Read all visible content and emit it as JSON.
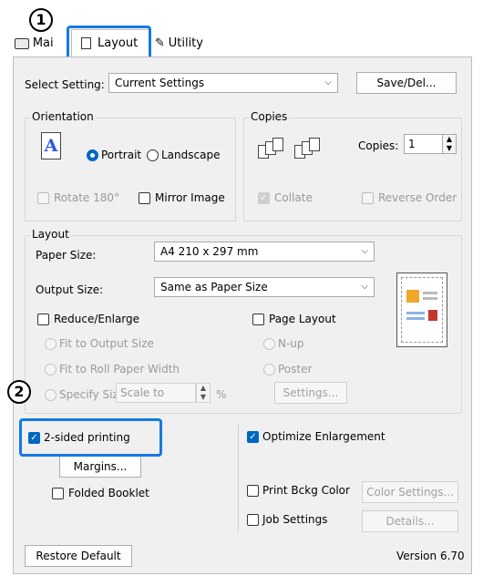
{
  "tabs": [
    {
      "label": "Mai"
    },
    {
      "label": "Layout"
    },
    {
      "label": "Utility"
    }
  ],
  "callouts": {
    "step1": "1",
    "step2": "2"
  },
  "select_setting": {
    "label": "Select Setting:",
    "value": "Current Settings",
    "save_button": "Save/Del..."
  },
  "orientation": {
    "title": "Orientation",
    "portrait": "Portrait",
    "landscape": "Landscape",
    "selected": "Portrait",
    "rotate": "Rotate 180°",
    "mirror": "Mirror Image",
    "preview_glyph": "A"
  },
  "copies": {
    "title": "Copies",
    "label": "Copies:",
    "value": "1",
    "collate": "Collate",
    "reverse": "Reverse Order"
  },
  "layout": {
    "title": "Layout",
    "paper_size_label": "Paper Size:",
    "paper_size_value": "A4 210 x 297 mm",
    "output_size_label": "Output Size:",
    "output_size_value": "Same as Paper Size",
    "reduce_enlarge": "Reduce/Enlarge",
    "fit_output": "Fit to Output Size",
    "fit_roll": "Fit to Roll Paper Width",
    "specify_size": "Specify Size",
    "scale_to": "Scale to",
    "percent": "%",
    "page_layout": "Page Layout",
    "nup": "N-up",
    "poster": "Poster",
    "settings_button": "Settings..."
  },
  "options": {
    "two_sided": "2-sided printing",
    "margins_button": "Margins...",
    "folded_booklet": "Folded Booklet",
    "optimize": "Optimize Enlargement",
    "print_bckg": "Print Bckg Color",
    "color_settings_button": "Color Settings...",
    "job_settings": "Job Settings",
    "details_button": "Details..."
  },
  "footer": {
    "restore_button": "Restore Default",
    "version": "Version 6.70"
  },
  "colors": {
    "accent": "#0067c0",
    "highlight": "#1479e6"
  }
}
